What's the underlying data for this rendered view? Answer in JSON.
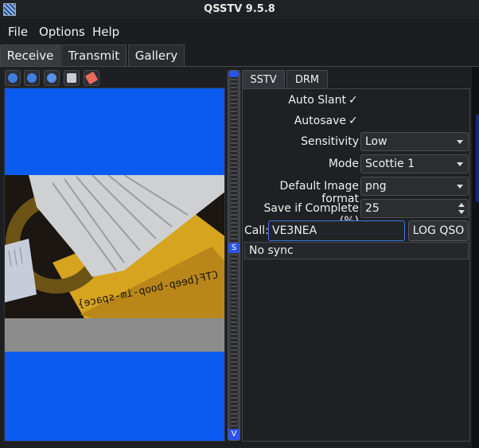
{
  "window": {
    "title": "QSSTV 9.5.8"
  },
  "menu": [
    "File",
    "Options",
    "Help"
  ],
  "tabs": {
    "receive": "Receive",
    "transmit": "Transmit",
    "gallery": "Gallery"
  },
  "toolbar": {
    "buttons": [
      "start-icon",
      "stop-icon",
      "resync-icon",
      "save-icon",
      "erase-icon"
    ]
  },
  "slider": {
    "handle_top_label": "S",
    "handle_bottom_label": "V"
  },
  "subtabs": {
    "sstv": "SSTV",
    "drm": "DRM"
  },
  "settings": {
    "auto_slant_label": "Auto Slant",
    "auto_slant_check": "✓",
    "autosave_label": "Autosave",
    "autosave_check": "✓",
    "sensitivity_label": "Sensitivity",
    "sensitivity_value": "Low",
    "mode_label": "Mode",
    "mode_value": "Scottie 1",
    "default_format_label": "Default Image format",
    "default_format_value": "png",
    "save_if_complete_label": "Save if Complete (%)",
    "save_if_complete_value": "25",
    "call_label": "Call:",
    "call_value": "VE3NEA",
    "log_qso_label": "LOG QSO",
    "status_text": "No sync"
  },
  "image": {
    "decoded_text": "CTF{beep-boop-im-space}"
  },
  "colors": {
    "image_background": "#0a5cf0",
    "accent": "#2b55e8"
  }
}
